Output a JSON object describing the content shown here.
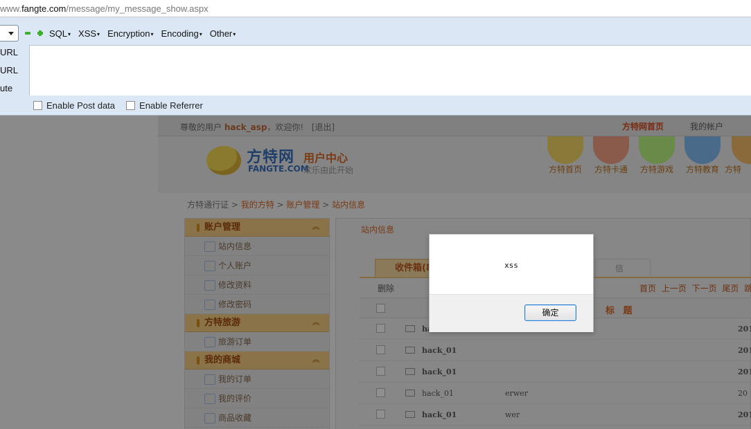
{
  "address_bar": {
    "prefix": "www.",
    "domain": "fangte.com",
    "path": "/message/my_message_show.aspx"
  },
  "hackbar": {
    "menus": [
      "SQL",
      "XSS",
      "Encryption",
      "Encoding",
      "Other"
    ],
    "side_labels": [
      "URL",
      "URL",
      "ute"
    ],
    "checkboxes": [
      "Enable Post data",
      "Enable Referrer"
    ]
  },
  "site": {
    "greeting_prefix": "尊敬的用户",
    "username": "hack_asp",
    "greeting_suffix": "，欢迎你!",
    "logout": "[退出]",
    "home_link": "方特网首页",
    "account_link": "我的帐户",
    "logo_cn": "方特网",
    "logo_center": "用户中心",
    "logo_en": "FANGTE.COM",
    "slogan": "欢乐由此开始",
    "nav": [
      "方特首页",
      "方特卡通",
      "方特游戏",
      "方特教育",
      "方特"
    ],
    "breadcrumb": [
      "方特通行证",
      "我的方特",
      "账户管理",
      "站内信息"
    ]
  },
  "sidebar": {
    "sections": [
      {
        "title": "账户管理",
        "items": [
          "站内信息",
          "个人账户",
          "修改资料",
          "修改密码"
        ]
      },
      {
        "title": "方特旅游",
        "items": [
          "旅游订单"
        ]
      },
      {
        "title": "我的商城",
        "items": [
          "我的订单",
          "我的评价",
          "商品收藏"
        ]
      }
    ]
  },
  "content": {
    "title": "站内信息",
    "tab_active": "收件箱(8",
    "tab_other": "信",
    "delete": "删除",
    "pager": "首页 上一页 下一页 尾页 跳转",
    "subject_header": "标 题",
    "rows": [
      {
        "from": "hac",
        "subject": "",
        "date": "201",
        "bold": true
      },
      {
        "from": "hack_01",
        "subject": "",
        "date": "201",
        "bold": true
      },
      {
        "from": "hack_01",
        "subject": "",
        "date": "201",
        "bold": true
      },
      {
        "from": "hack_01",
        "subject": "erwer",
        "date": "20",
        "bold": false
      },
      {
        "from": "hack_01",
        "subject": "wer",
        "date": "201",
        "bold": true
      }
    ]
  },
  "alert": {
    "message": "xss",
    "ok_label": "确定"
  }
}
